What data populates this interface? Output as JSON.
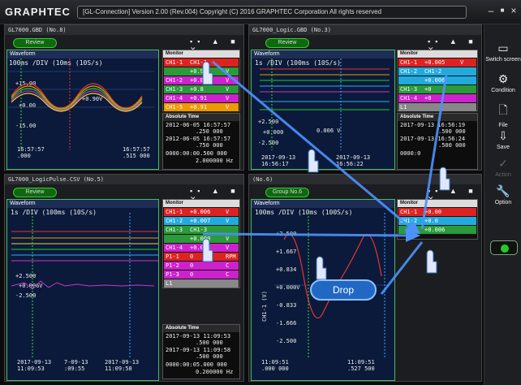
{
  "app": {
    "logo": "GRAPHTEC",
    "title": "[GL-Connection] Version 2.00 (Rev.004)   Copyright (C) 2016 GRAPHTEC Corporation All rights reserved",
    "win_minimize": "–",
    "win_maximize": "■",
    "win_close": "×"
  },
  "right_panel": {
    "items": [
      {
        "label": "Switch screen",
        "icon": "screen-icon",
        "glyph": "▭"
      },
      {
        "label": "Condition",
        "icon": "gear-icon",
        "glyph": "⚙"
      },
      {
        "label": "File",
        "icon": "file-icon",
        "glyph": "🗋"
      },
      {
        "label": "Save",
        "icon": "save-icon",
        "glyph": "⇩"
      },
      {
        "label": "Action",
        "icon": "check-icon",
        "glyph": "✓"
      },
      {
        "label": "Option",
        "icon": "wrench-icon",
        "glyph": "🔧"
      }
    ]
  },
  "panes": [
    {
      "title": "GL7000.GBD (No.8)",
      "review": "Review",
      "wave_label": "Waveform",
      "timebase": "100ms /DIV (10ms (10S/s)",
      "levels": [
        "+15.00",
        "+0.00",
        "-15.00"
      ],
      "marker_value": "+0.90V",
      "bottom_left": "16:57:57\n.000",
      "bottom_right": "16:57:57\n.515 000",
      "monitor": {
        "title": "Monitor",
        "rows": [
          {
            "ch": "CH1-1",
            "val": "CH1-1",
            "unit": "",
            "color": "#d22"
          },
          {
            "ch": "",
            "val": "+0.90",
            "unit": "V",
            "color": "#2a9a3a"
          },
          {
            "ch": "CH1-2",
            "val": "+0.8",
            "unit": "V",
            "color": "#c2c"
          },
          {
            "ch": "CH1-3",
            "val": "+0.8",
            "unit": "V",
            "color": "#2a9a3a"
          },
          {
            "ch": "CH1-4",
            "val": "+0.91",
            "unit": "V",
            "color": "#c2c"
          },
          {
            "ch": "CH1-5",
            "val": "+0.91",
            "unit": "V",
            "color": "#e90"
          }
        ]
      },
      "abs_time": {
        "title": "Absolute Time",
        "rows": [
          "2012-06-05 16:57:57",
          ".250 000",
          "2012-06-05 16:57:57",
          ".750 000",
          "0000:00:00.500 000",
          "2.000000 Hz"
        ]
      }
    },
    {
      "title": "GL7000_Logic.GBD (No.3)",
      "review": "Review",
      "wave_label": "Waveform",
      "timebase": "1s   /DIV (100ms (10S/s)",
      "levels": [
        "+2.500",
        "+0.000",
        "-2.500"
      ],
      "marker_value": "0.006 V",
      "bottom_left": "2017-09-13\n16:56:17",
      "bottom_right": "2017-09-13\n16:56:22",
      "monitor": {
        "title": "Monitor",
        "rows": [
          {
            "ch": "CH1-1",
            "val": "+0.005",
            "unit": "V",
            "color": "#d22"
          },
          {
            "ch": "CH1-2",
            "val": "CH1-2",
            "unit": "",
            "color": "#2ad"
          },
          {
            "ch": "",
            "val": "+0.006",
            "unit": "",
            "color": "#2ad"
          },
          {
            "ch": "CH1-3",
            "val": "+0",
            "unit": "",
            "color": "#2a9a3a"
          },
          {
            "ch": "CH1-4",
            "val": "+0",
            "unit": "",
            "color": "#c2c"
          },
          {
            "ch": "L1",
            "val": "",
            "unit": "",
            "color": "#888"
          }
        ]
      },
      "abs_time": {
        "title": "Absolute Time",
        "rows": [
          "2017-09-13 16:56:19",
          ".500 000",
          "2017-09-13 16:56:24",
          ".500 000",
          "0000:0",
          ""
        ]
      }
    },
    {
      "title": "GL7000_LogicPulse.CSV (No.5)",
      "review": "Review",
      "wave_label": "Waveform",
      "timebase": "1s   /DIV (100ms (10S/s)",
      "levels": [
        "+2.500",
        "+0.006V",
        "-2.500"
      ],
      "marker_value": "+0.006V",
      "bottom_left": "2017-09-13\n11:09:53",
      "bottom_right": "2017-09-13\n11:09:58",
      "bottom_mid": "7-09-13\n:09:55",
      "monitor": {
        "title": "Monitor",
        "rows": [
          {
            "ch": "CH1-1",
            "val": "+0.006",
            "unit": "V",
            "color": "#d22"
          },
          {
            "ch": "CH1-2",
            "val": "+0.007",
            "unit": "V",
            "color": "#2ad"
          },
          {
            "ch": "CH1-3",
            "val": "CH1-3",
            "unit": "",
            "color": "#2a9a3a"
          },
          {
            "ch": "",
            "val": "+0.000",
            "unit": "V",
            "color": "#2a9a3a"
          },
          {
            "ch": "CH1-4",
            "val": "+0.008",
            "unit": "V",
            "color": "#c2c"
          },
          {
            "ch": "P1-1",
            "val": "0",
            "unit": "RPM",
            "color": "#d22"
          },
          {
            "ch": "P1-2",
            "val": "0",
            "unit": "C",
            "color": "#c2c"
          },
          {
            "ch": "P1-3",
            "val": "0",
            "unit": "C",
            "color": "#c2c"
          },
          {
            "ch": "L1",
            "val": "",
            "unit": "",
            "color": "#888"
          }
        ]
      },
      "abs_time": {
        "title": "Absolute Time",
        "rows": [
          "2017-09-13 11:09:53",
          ".500 000",
          "2017-09-13 11:09:58",
          ".500 000",
          "0000:00:05.000 000",
          "0.200000 Hz"
        ]
      }
    },
    {
      "title": "(No.6)",
      "review": "Group No.6",
      "wave_label": "Waveform",
      "timebase": "100ms /DIV (10ms (100S/s)",
      "levels": [
        "+2.500",
        "+1.667",
        "+0.834",
        "+0.000V",
        "-0.833",
        "-1.666",
        "-2.500"
      ],
      "axis_title": "CH1-1 (V)",
      "bottom_left": "11:09:51\n.000 000",
      "bottom_right": "11:09:51\n.527 500",
      "monitor": {
        "title": "Monitor",
        "rows": [
          {
            "ch": "CH1-1",
            "val": "+0.00",
            "unit": "",
            "color": "#d22"
          },
          {
            "ch": "CH1-2",
            "val": "+0.0",
            "unit": "",
            "color": "#2ad"
          },
          {
            "ch": "",
            "val": "+0.006",
            "unit": "",
            "color": "#2a9a3a"
          }
        ]
      }
    }
  ],
  "drop_label": "Drop"
}
